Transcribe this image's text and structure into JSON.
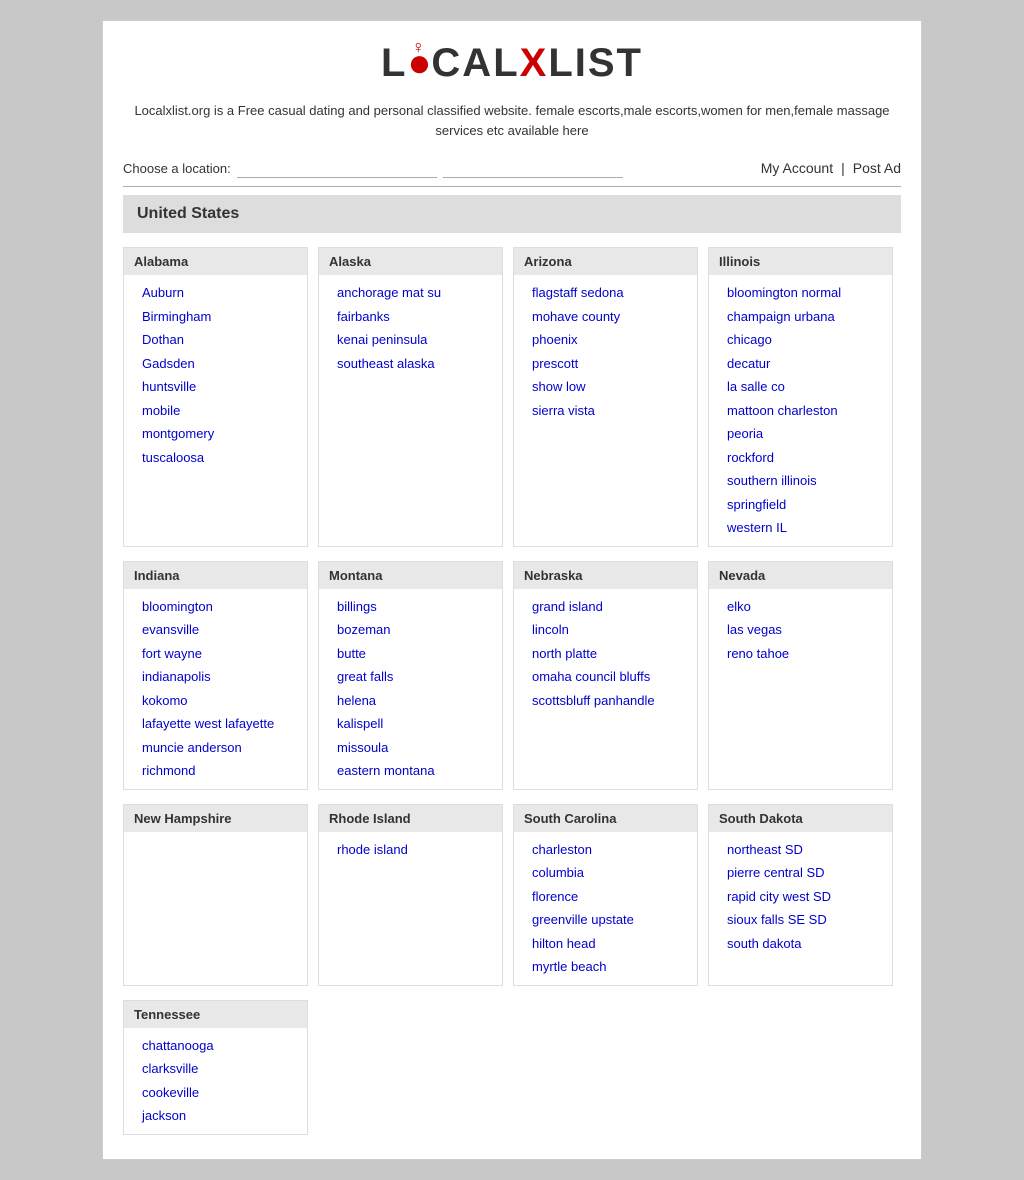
{
  "logo": {
    "text": "LOCALXLIST"
  },
  "tagline": "Localxlist.org is a Free casual dating and personal classified website. female escorts,male escorts,women for men,female massage services etc available here",
  "toolbar": {
    "location_label": "Choose a location:",
    "location_placeholder": "",
    "search_placeholder": "",
    "my_account": "My Account",
    "separator": "|",
    "post_ad": "Post Ad"
  },
  "section_title": "United States",
  "states": [
    {
      "name": "Alabama",
      "cities": [
        "Auburn",
        "Birmingham",
        "Dothan",
        "Gadsden",
        "huntsville",
        "mobile",
        "montgomery",
        "tuscaloosa"
      ]
    },
    {
      "name": "Alaska",
      "cities": [
        "anchorage mat su",
        "fairbanks",
        "kenai peninsula",
        "southeast alaska"
      ]
    },
    {
      "name": "Arizona",
      "cities": [
        "flagstaff sedona",
        "mohave county",
        "phoenix",
        "prescott",
        "show low",
        "sierra vista"
      ]
    },
    {
      "name": "Illinois",
      "cities": [
        "bloomington normal",
        "champaign urbana",
        "chicago",
        "decatur",
        "la salle co",
        "mattoon charleston",
        "peoria",
        "rockford",
        "southern illinois",
        "springfield",
        "western IL"
      ]
    },
    {
      "name": "Indiana",
      "cities": [
        "bloomington",
        "evansville",
        "fort wayne",
        "indianapolis",
        "kokomo",
        "lafayette west lafayette",
        "muncie anderson",
        "richmond"
      ]
    },
    {
      "name": "Montana",
      "cities": [
        "billings",
        "bozeman",
        "butte",
        "great falls",
        "helena",
        "kalispell",
        "missoula",
        "eastern montana"
      ]
    },
    {
      "name": "Nebraska",
      "cities": [
        "grand island",
        "lincoln",
        "north platte",
        "omaha council bluffs",
        "scottsbluff panhandle"
      ]
    },
    {
      "name": "Nevada",
      "cities": [
        "elko",
        "las vegas",
        "reno tahoe"
      ]
    },
    {
      "name": "New Hampshire",
      "cities": []
    },
    {
      "name": "Rhode Island",
      "cities": [
        "rhode island"
      ]
    },
    {
      "name": "South Carolina",
      "cities": [
        "charleston",
        "columbia",
        "florence",
        "greenville upstate",
        "hilton head",
        "myrtle beach"
      ]
    },
    {
      "name": "South Dakota",
      "cities": [
        "northeast SD",
        "pierre central SD",
        "rapid city west SD",
        "sioux falls SE SD",
        "south dakota"
      ]
    },
    {
      "name": "Tennessee",
      "cities": [
        "chattanooga",
        "clarksville",
        "cookeville",
        "jackson"
      ]
    }
  ]
}
